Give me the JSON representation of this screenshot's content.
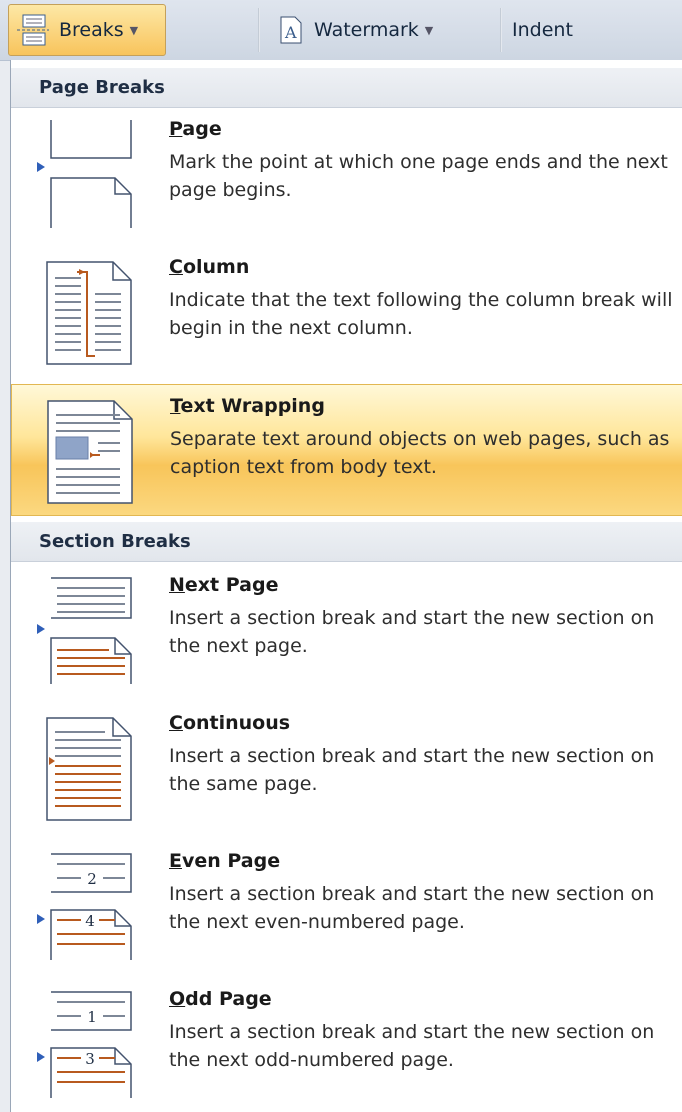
{
  "ribbon": {
    "breaks_label": "Breaks",
    "watermark_label": "Watermark",
    "indent_label": "Indent"
  },
  "menu": {
    "page_breaks_header": "Page Breaks",
    "section_breaks_header": "Section Breaks",
    "items": [
      {
        "accel": "P",
        "rest": "age",
        "desc": "Mark the point at which one page ends and the next page begins."
      },
      {
        "accel": "C",
        "rest": "olumn",
        "desc": "Indicate that the text following the column break will begin in the next column."
      },
      {
        "accel": "T",
        "rest": "ext Wrapping",
        "desc": "Separate text around objects on web pages, such as caption text from body text."
      },
      {
        "accel": "N",
        "rest": "ext Page",
        "desc": "Insert a section break and start the new section on the next page."
      },
      {
        "accel": "C",
        "rest": "ontinuous",
        "desc": "Insert a section break and start the new section on the same page."
      },
      {
        "accel": "E",
        "rest": "ven Page",
        "desc": "Insert a section break and start the new section on the next even-numbered page."
      },
      {
        "accel": "O",
        "rest": "dd Page",
        "desc": "Insert a section break and start the new section on the next odd-numbered page."
      }
    ],
    "even_page_numbers": [
      "2",
      "4"
    ],
    "odd_page_numbers": [
      "1",
      "3"
    ]
  },
  "colors": {
    "highlight": "#f8c55a",
    "break_marker": "#b85a1f",
    "arrow": "#2f5fb8"
  }
}
